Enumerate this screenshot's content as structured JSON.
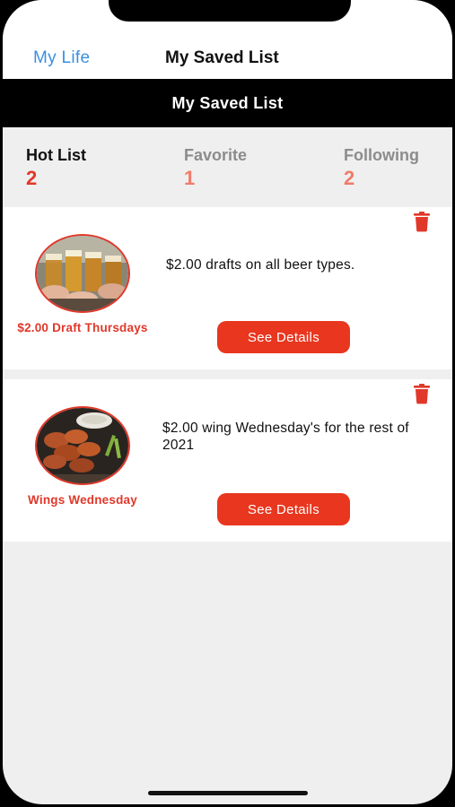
{
  "nav": {
    "back_label": "My Life",
    "title": "My Saved List"
  },
  "header_bar": {
    "title": "My Saved List"
  },
  "tabs": [
    {
      "label": "Hot List",
      "count": "2",
      "active": true
    },
    {
      "label": "Favorite",
      "count": "1",
      "active": false
    },
    {
      "label": "Following",
      "count": "2",
      "active": false
    }
  ],
  "items": [
    {
      "title": "$2.00 Draft Thursdays",
      "description": "$2.00 drafts on all beer types.",
      "button_label": "See Details",
      "image": "beer-toast-photo",
      "delete_icon": "trash-icon"
    },
    {
      "title": "Wings Wednesday",
      "description": "$2.00 wing Wednesday's for the rest of 2021",
      "button_label": "See Details",
      "image": "chicken-wings-photo",
      "delete_icon": "trash-icon"
    }
  ],
  "colors": {
    "accent_red": "#e8361f",
    "link_blue": "#3b8fe0",
    "inactive_gray": "#8c8c8c",
    "inactive_count": "#f07b6a",
    "bar_black": "#000000",
    "background": "#efefef"
  }
}
